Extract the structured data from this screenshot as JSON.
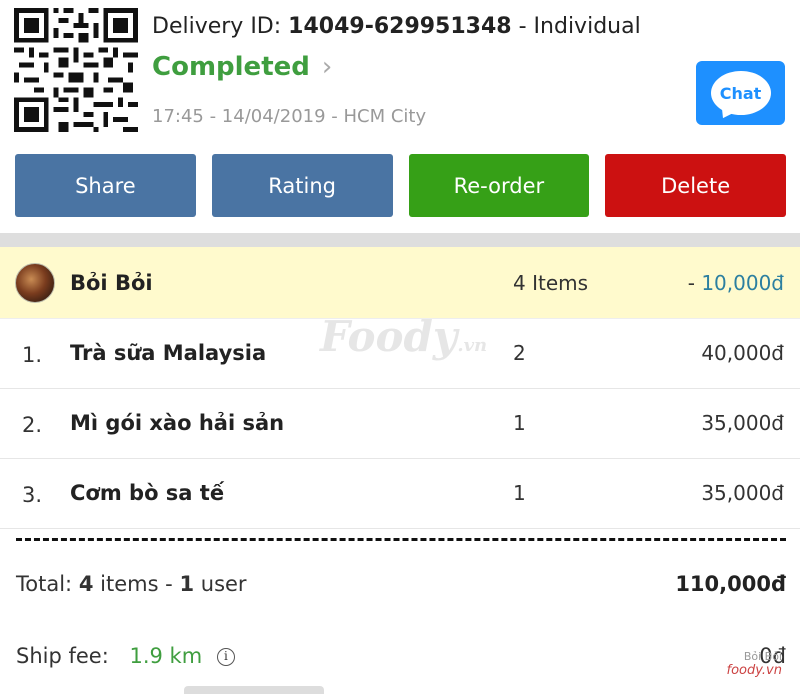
{
  "header": {
    "delivery_label": "Delivery ID:",
    "delivery_id": "14049-629951348",
    "delivery_type": "Individual",
    "status": "Completed",
    "time": "17:45 - 14/04/2019 - HCM City",
    "chat_label": "Chat"
  },
  "actions": {
    "share": "Share",
    "rating": "Rating",
    "reorder": "Re-order",
    "delete": "Delete"
  },
  "user": {
    "name": "Bỏi Bỏi",
    "items_count": "4 Items",
    "discount_prefix": "-",
    "discount": "10,000đ"
  },
  "watermark": {
    "brand": "Foody",
    "suffix": ".vn"
  },
  "items": [
    {
      "no": "1.",
      "name": "Trà sữa Malaysia",
      "qty": "2",
      "price": "40,000đ"
    },
    {
      "no": "2.",
      "name": "Mì gói xào hải sản",
      "qty": "1",
      "price": "35,000đ"
    },
    {
      "no": "3.",
      "name": "Cơm bò sa tế",
      "qty": "1",
      "price": "35,000đ"
    }
  ],
  "total": {
    "label": "Total:",
    "items_num": "4",
    "items_word": "items -",
    "users_num": "1",
    "users_word": "user",
    "amount": "110,000đ"
  },
  "ship": {
    "label": "Ship fee:",
    "distance": "1.9 km",
    "amount": "0đ"
  },
  "corner_watermark": {
    "top": "Bỏi Bỏi",
    "brand": "foody.vn"
  },
  "colors": {
    "completed": "#3f9e3f",
    "share_rating": "#4a74a3",
    "reorder": "#36a017",
    "delete": "#cc1111",
    "chat": "#1e90ff",
    "user_row_bg": "#fffacd"
  }
}
